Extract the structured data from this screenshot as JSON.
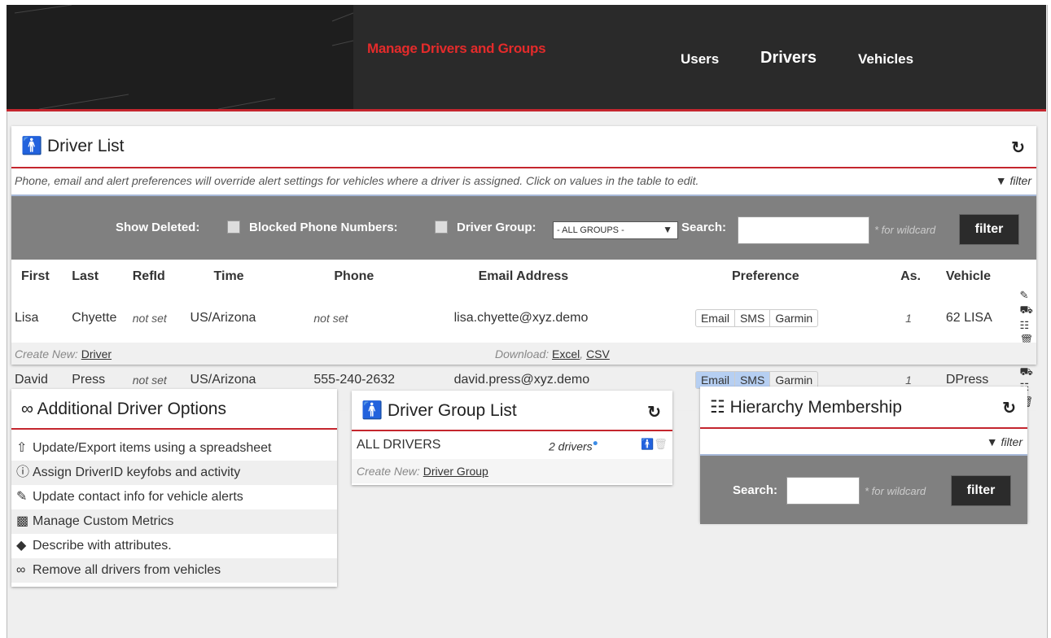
{
  "header": {
    "app_title": "Manage Drivers and Groups",
    "nav": {
      "users": "Users",
      "drivers": "Drivers",
      "vehicles": "Vehicles"
    }
  },
  "driver_list": {
    "title": "Driver List",
    "note": "Phone, email and alert preferences will override alert settings for vehicles where a driver is assigned. Click on values in the table to edit.",
    "filter_link": "filter",
    "filters": {
      "show_deleted": "Show Deleted:",
      "blocked": "Blocked Phone Numbers:",
      "group": "Driver Group:",
      "group_value": "- ALL GROUPS -",
      "search": "Search:",
      "wildcard": "* for wildcard",
      "button": "filter"
    },
    "columns": [
      "First",
      "Last",
      "RefId",
      "Time",
      "Phone",
      "Email Address",
      "Preference",
      "As.",
      "Vehicle"
    ],
    "rows": [
      {
        "first": "Lisa",
        "last": "Chyette",
        "refid": "not set",
        "time": "US/Arizona",
        "phone": "not set",
        "email": "lisa.chyette@xyz.demo",
        "pref": [
          "Email",
          "SMS",
          "Garmin"
        ],
        "as": "1",
        "vehicle": "62 LISA"
      },
      {
        "first": "David",
        "last": "Press",
        "refid": "not set",
        "time": "US/Arizona",
        "phone": "555-240-2632",
        "email": "david.press@xyz.demo",
        "pref": [
          "Email",
          "SMS",
          "Garmin"
        ],
        "as": "1",
        "vehicle": "DPress"
      }
    ],
    "footer": {
      "create_label": "Create New:",
      "create_link": "Driver",
      "download_label": "Download:",
      "excel": "Excel",
      "csv": "CSV"
    }
  },
  "additional": {
    "title": "Additional Driver Options",
    "items": [
      "Update/Export items using a spreadsheet",
      "Assign DriverID keyfobs and activity",
      "Update contact info for vehicle alerts",
      "Manage Custom Metrics",
      "Describe with attributes.",
      "Remove all drivers from vehicles"
    ]
  },
  "group_list": {
    "title": "Driver Group List",
    "row_name": "ALL DRIVERS",
    "row_count": "2 drivers",
    "create_label": "Create New:",
    "create_link": "Driver Group"
  },
  "hierarchy": {
    "title": "Hierarchy Membership",
    "filter_link": "filter",
    "search": "Search:",
    "wildcard": "* for wildcard",
    "button": "filter"
  }
}
